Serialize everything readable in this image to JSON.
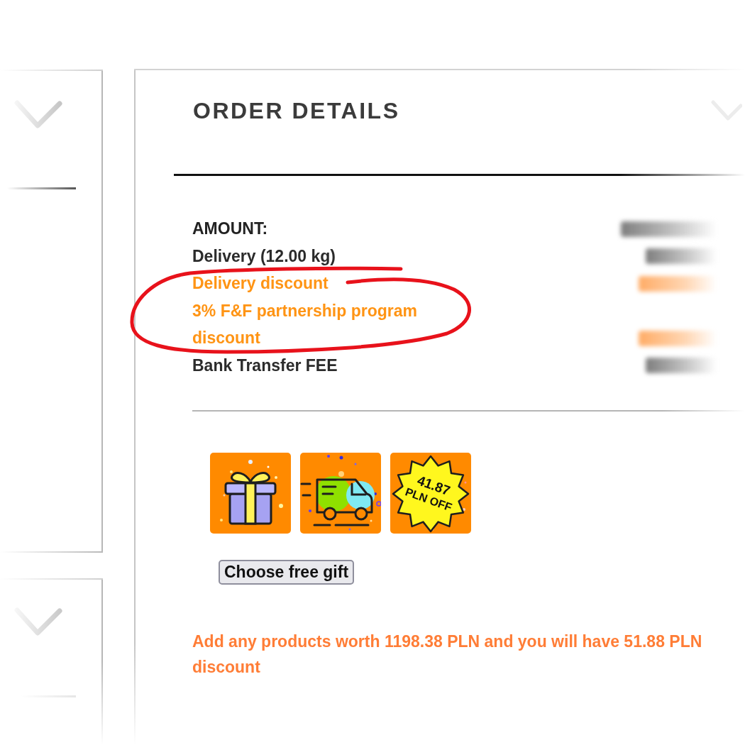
{
  "order_details": {
    "title": "ORDER DETAILS",
    "rows": [
      {
        "label": "AMOUNT:",
        "kind": "total"
      },
      {
        "label": "Delivery (12.00 kg)",
        "kind": "charge"
      },
      {
        "label": "Delivery discount",
        "kind": "discount"
      },
      {
        "label": "3% F&F partnership program discount",
        "kind": "discount"
      },
      {
        "label": "Bank Transfer FEE",
        "kind": "charge"
      }
    ],
    "promo_tiles": [
      {
        "kind": "gift"
      },
      {
        "kind": "delivery"
      },
      {
        "kind": "price_off",
        "lines": [
          "41.87",
          "PLN OFF"
        ]
      }
    ],
    "gift_button": "Choose free gift",
    "promo_message": "Add any products worth 1198.38 PLN and you will have 51.88 PLN discount"
  },
  "annotation": {
    "kind": "ellipse"
  }
}
